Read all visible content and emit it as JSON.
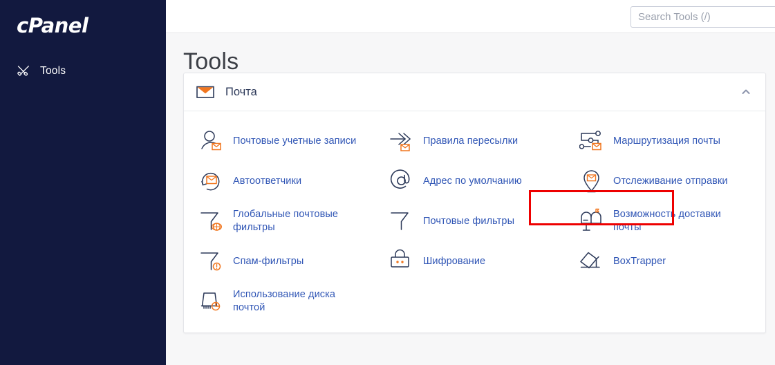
{
  "sidebar": {
    "logo_text": "cPanel",
    "nav": [
      {
        "label": "Tools",
        "icon": "tools-icon"
      }
    ]
  },
  "topbar": {
    "search": {
      "placeholder": "Search Tools (/)",
      "value": ""
    }
  },
  "page": {
    "title": "Tools"
  },
  "section": {
    "title": "Почта",
    "icon": "envelope-icon",
    "collapse_icon": "chevron-up-icon",
    "expanded": true,
    "tools": [
      {
        "label": "Почтовые учетные записи",
        "icon": "user-mail-icon",
        "two_line": false
      },
      {
        "label": "Правила пересылки",
        "icon": "forward-arrow-mail-icon",
        "two_line": false
      },
      {
        "label": "Маршрутизация почты",
        "icon": "routing-mail-icon",
        "two_line": false
      },
      {
        "label": "Автоответчики",
        "icon": "autoresponder-icon",
        "two_line": false
      },
      {
        "label": "Адрес по умолчанию",
        "icon": "at-sign-icon",
        "two_line": false,
        "highlighted": true
      },
      {
        "label": "Отслеживание отправки",
        "icon": "map-pin-mail-icon",
        "two_line": false
      },
      {
        "label": "Глобальные почтовые фильтры",
        "icon": "funnel-globe-icon",
        "two_line": true
      },
      {
        "label": "Почтовые фильтры",
        "icon": "funnel-icon",
        "two_line": false
      },
      {
        "label": "Возможность доставки почты",
        "icon": "mailbox-icon",
        "two_line": true
      },
      {
        "label": "Спам-фильтры",
        "icon": "funnel-warning-icon",
        "two_line": false
      },
      {
        "label": "Шифрование",
        "icon": "padlock-icon",
        "two_line": false
      },
      {
        "label": "BoxTrapper",
        "icon": "boxtrapper-icon",
        "two_line": false
      },
      {
        "label": "Использование диска почтой",
        "icon": "disk-usage-icon",
        "two_line": true
      }
    ]
  },
  "colors": {
    "sidebar_bg": "#12193f",
    "link_blue": "#2f55b5",
    "accent_orange": "#f1761f",
    "icon_navy": "#2b3858",
    "highlight_red": "#ee0000"
  }
}
